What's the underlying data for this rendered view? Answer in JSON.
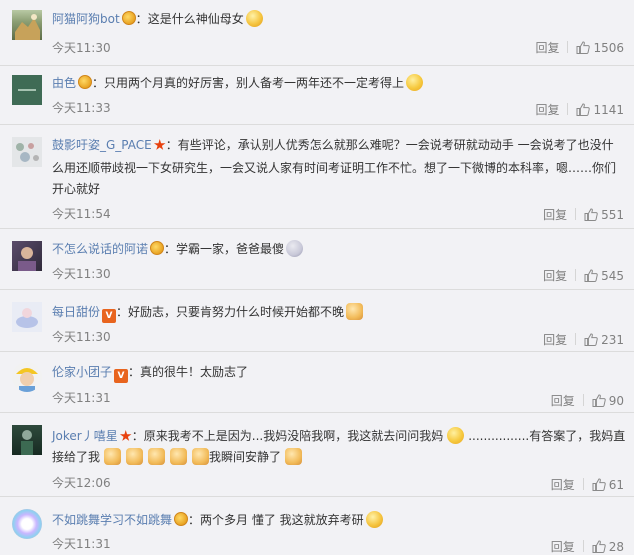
{
  "ui": {
    "reply_label": "回复"
  },
  "comments": [
    {
      "user": "阿猫阿狗bot",
      "sep": "：",
      "text": "这是什么神仙母女",
      "time": "今天11:30",
      "likes": "1506"
    },
    {
      "user": "由色",
      "sep": "：",
      "text": "只用两个月真的好厉害，别人备考一两年还不一定考得上",
      "time": "今天11:33",
      "likes": "1141"
    },
    {
      "user": "鼓影吁姿_G_PACE",
      "sep": "：",
      "text_line1": "有些评论，承认别人优秀怎么就那么难呢？一会说考研就动动手 一会说考了也没什",
      "text_line2": "么用还顺带歧视一下女研究生，一会又说人家有时间考证明工作不忙。想了一下微博的本科率，嗯……你们",
      "text_line3": "开心就好",
      "time": "今天11:54",
      "likes": "551"
    },
    {
      "user": "不怎么说话的阿诺",
      "sep": "：",
      "text": "学霸一家，爸爸最傻",
      "time": "今天11:30",
      "likes": "545"
    },
    {
      "user": "每日甜份",
      "sep": "：",
      "text": "好励志，只要肯努力什么时候开始都不晚",
      "time": "今天11:30",
      "likes": "231"
    },
    {
      "user": "伦家小团子",
      "sep": "：",
      "text": "真的很牛！太励志了",
      "time": "今天11:31",
      "likes": "90"
    },
    {
      "user": "Joker丿嘻星",
      "sep": "：",
      "text_line1a": "原来我考不上是因为...我妈没陪我啊，我这就去问问我妈",
      "text_line1b": "................有答案了，我妈直",
      "text_line2": "接给了我",
      "text_line2b": "我瞬间安静了",
      "time": "今天12:06",
      "likes": "61"
    },
    {
      "user": "不如跳舞学习不如跳舞",
      "sep": "：",
      "text": "两个多月 懂了 我这就放弃考研",
      "time": "今天11:31",
      "likes": "28"
    }
  ]
}
